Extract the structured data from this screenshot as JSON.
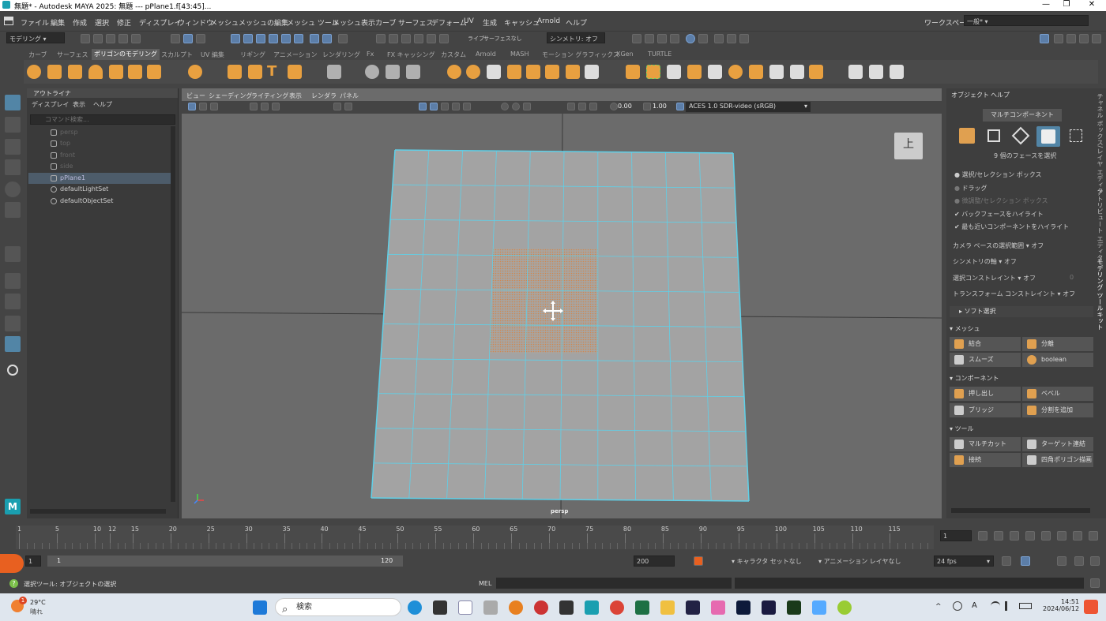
{
  "title": "無題* - Autodesk MAYA 2025: 無題   ---   pPlane1.f[43:45]...",
  "menu": [
    "ファイル",
    "編集",
    "作成",
    "選択",
    "修正",
    "ディスプレイ",
    "ウィンドウ",
    "メッシュ",
    "メッシュの編集",
    "メッシュ ツール",
    "メッシュ表示",
    "カーブ",
    "サーフェス",
    "デフォーム",
    "UV",
    "生成",
    "キャッシュ",
    "Arnold",
    "ヘルプ"
  ],
  "workspace_label": "ワークスペース:",
  "workspace_value": "一般*",
  "status": {
    "mode": "モデリング",
    "live": "ライブ",
    "live_value": "サーフェスなし",
    "symmetry": "シンメトリ: オフ"
  },
  "shelf_tabs": [
    "カーブ",
    "サーフェス",
    "ポリゴンのモデリング",
    "スカルプト",
    "UV 編集",
    "リギング",
    "アニメーション",
    "レンダリング",
    "Fx",
    "FX キャッシング",
    "カスタム",
    "Arnold",
    "MASH",
    "モーション グラフィックス",
    "XGen",
    "TURTLE"
  ],
  "shelf_active": "ポリゴンのモデリング",
  "outliner": {
    "title": "アウトライナ",
    "menu": [
      "ディスプレイ",
      "表示",
      "ヘルプ"
    ],
    "search_placeholder": "コマンド検索...",
    "items": [
      "persp",
      "top",
      "front",
      "side",
      "pPlane1",
      "defaultLightSet",
      "defaultObjectSet"
    ]
  },
  "viewport": {
    "menu": [
      "ビュー",
      "シェーディング",
      "ライティング",
      "表示",
      "レンダラ",
      "パネル"
    ],
    "value1": "0.00",
    "value2": "1.00",
    "colorspace": "ACES 1.0 SDR-video (sRGB)",
    "camera": "persp",
    "viewcube_label": "上"
  },
  "right_panel": {
    "menu": [
      "オブジェクト",
      "ヘルプ"
    ],
    "multi_component": "マルチコンポーネント",
    "faces_selected": "9 個のフェースを選択",
    "options": [
      "選択/セレクション ボックス",
      "ドラッグ",
      "微調整/セレクション ボックス"
    ],
    "checks": [
      "バックフェースをハイライト",
      "最も近いコンポーネントをハイライト"
    ],
    "settings": [
      {
        "label": "カメラ ベースの選択範囲",
        "value": "オフ"
      },
      {
        "label": "シンメトリの軸",
        "value": "オフ"
      },
      {
        "label": "選択コンストレイント",
        "value": "オフ",
        "extra": "0"
      },
      {
        "label": "トランスフォーム コンストレイント",
        "value": "オフ"
      }
    ],
    "soft_select": "ソフト選択",
    "sections": {
      "mesh": "メッシュ",
      "component": "コンポーネント",
      "tools": "ツール"
    },
    "mesh_buttons": [
      "結合",
      "分離",
      "スムーズ",
      "boolean"
    ],
    "component_buttons": [
      "押し出し",
      "ベベル",
      "ブリッジ",
      "分割を追加"
    ],
    "tool_buttons": [
      "マルチカット",
      "ターゲット連結",
      "接続",
      "四角ポリゴン描画"
    ],
    "vertical_tabs": [
      "チャネル ボックス/レイヤ エディタ",
      "アトリビュート エディタ",
      "モデリング ツールキット"
    ]
  },
  "timeline": {
    "ticks": [
      "1",
      "5",
      "10",
      "15",
      "20",
      "25",
      "30",
      "35",
      "40",
      "45",
      "50",
      "55",
      "60",
      "65",
      "70",
      "75",
      "80",
      "85",
      "90",
      "95",
      "100",
      "105",
      "110",
      "115",
      "12"
    ],
    "current_frame": "1",
    "range_start": "1",
    "range_inner_start": "1",
    "range_inner_end": "120",
    "range_end": "200",
    "character_set": "キャラクタ セットなし",
    "anim_layer": "アニメーション レイヤなし",
    "fps": "24 fps"
  },
  "command": {
    "help_text": "選択ツール: オブジェクトの選択",
    "language": "MEL"
  },
  "taskbar": {
    "weather_temp": "29°C",
    "weather_desc": "晴れ",
    "search_placeholder": "検索",
    "time": "14:51",
    "date": "2024/06/12"
  }
}
